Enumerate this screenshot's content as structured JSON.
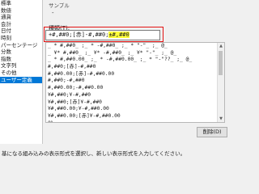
{
  "categories": [
    "標準",
    "数値",
    "通貨",
    "会計",
    "日付",
    "時刻",
    "パーセンテージ",
    "分数",
    "指数",
    "文字列",
    "その他",
    "ユーザー定義"
  ],
  "selected_category_index": 11,
  "sample": {
    "label": "サンプル",
    "value": "-"
  },
  "type_label": "種類(T):",
  "format_input": {
    "prefix": "+#,##0;[赤]-#,##0;",
    "highlighted": "±#,##0"
  },
  "format_list": [
    "_ * #,##0_ ;_ * -#,##0_ ;_ * \"-\"_ ;_ @_",
    "_ ¥* #,##0_ ;_ ¥* -#,##0_ ;_ ¥* \"-\"_ ;_ @_",
    "_ * #,##0.00_ ;_ * -#,##0.00_ ;_ * \"-\"??_ ;_ @_",
    "#,##0;[赤]-#,##0",
    "#,##0.00;[赤]-#,##0.00",
    "#,##0;-#,##0",
    "#,##0.00;-#,##0.00",
    "¥#,##0;¥-#,##0",
    "¥#,##0;[赤]¥-#,##0",
    "¥#,##0.00;¥-#,##0.00",
    "¥#,##0.00;[赤]¥-#,##0.00",
    "0%",
    "0.00%"
  ],
  "delete_button": "削除(D)",
  "hint": "基になる組み込みの表示形式を選択し、新しい表示形式を入力してください。"
}
